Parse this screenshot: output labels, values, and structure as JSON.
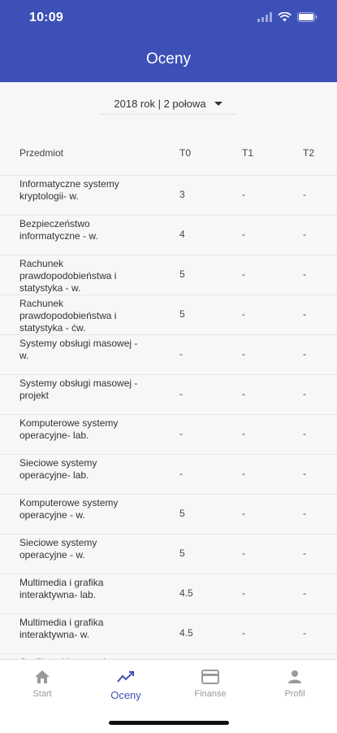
{
  "status_bar": {
    "time": "10:09"
  },
  "header": {
    "title": "Oceny"
  },
  "semester_selector": {
    "value": "2018 rok | 2 połowa"
  },
  "table": {
    "columns": [
      "Przedmiot",
      "T0",
      "T1",
      "T2"
    ],
    "rows": [
      {
        "subject": "Informatyczne systemy kryptologii- w.",
        "t0": "3",
        "t1": "-",
        "t2": "-"
      },
      {
        "subject": "Bezpieczeństwo informatyczne - w.",
        "t0": "4",
        "t1": "-",
        "t2": "-"
      },
      {
        "subject": "Rachunek prawdopodobieństwa i statystyka - w.",
        "t0": "5",
        "t1": "-",
        "t2": "-"
      },
      {
        "subject": "Rachunek prawdopodobieństwa i statystyka - ćw.",
        "t0": "5",
        "t1": "-",
        "t2": "-"
      },
      {
        "subject": "Systemy obsługi masowej - w.",
        "t0": "-",
        "t1": "-",
        "t2": "-"
      },
      {
        "subject": "Systemy obsługi masowej - projekt",
        "t0": "-",
        "t1": "-",
        "t2": "-"
      },
      {
        "subject": "Komputerowe systemy operacyjne- lab.",
        "t0": "-",
        "t1": "-",
        "t2": "-"
      },
      {
        "subject": "Sieciowe systemy operacyjne- lab.",
        "t0": "-",
        "t1": "-",
        "t2": "-"
      },
      {
        "subject": "Komputerowe systemy operacyjne - w.",
        "t0": "5",
        "t1": "-",
        "t2": "-"
      },
      {
        "subject": "Sieciowe systemy operacyjne - w.",
        "t0": "5",
        "t1": "-",
        "t2": "-"
      },
      {
        "subject": "Multimedia i grafika interaktywna- lab.",
        "t0": "4.5",
        "t1": "-",
        "t2": "-"
      },
      {
        "subject": "Multimedia i grafika interaktywna- w.",
        "t0": "4.5",
        "t1": "-",
        "t2": "-"
      },
      {
        "subject": "Grafika reklamowa i",
        "t0": "",
        "t1": "",
        "t2": ""
      }
    ]
  },
  "tabbar": {
    "items": [
      {
        "label": "Start",
        "icon": "home-icon",
        "active": false
      },
      {
        "label": "Oceny",
        "icon": "chart-line-icon",
        "active": true
      },
      {
        "label": "Finanse",
        "icon": "credit-card-icon",
        "active": false
      },
      {
        "label": "Profil",
        "icon": "person-icon",
        "active": false
      }
    ]
  },
  "colors": {
    "primary": "#3d50b8",
    "inactive": "#9a9a9a"
  }
}
